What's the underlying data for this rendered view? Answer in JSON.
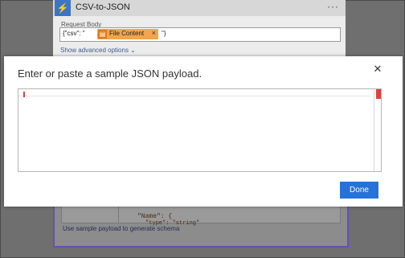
{
  "card": {
    "title": "CSV-to-JSON",
    "more_icon": "ellipsis-icon",
    "field_label": "Request Body",
    "field_prefix": "{\"csv\": \"",
    "token_label": "File Content",
    "token_close": "×",
    "field_suffix": "\"}",
    "advanced_options": "Show advanced options ⌄"
  },
  "lower": {
    "code_line1": "\"Name\": {",
    "code_line2": "\"type\": \"string\"",
    "schema_link": "Use sample payload to generate schema"
  },
  "dialog": {
    "title": "Enter or paste a sample JSON payload.",
    "close": "✕",
    "json_value": "",
    "done": "Done"
  },
  "colors": {
    "accent": "#2672d8",
    "token": "#f2a54a",
    "action_icon": "#3a76c4",
    "panel_border": "#6650b4"
  }
}
